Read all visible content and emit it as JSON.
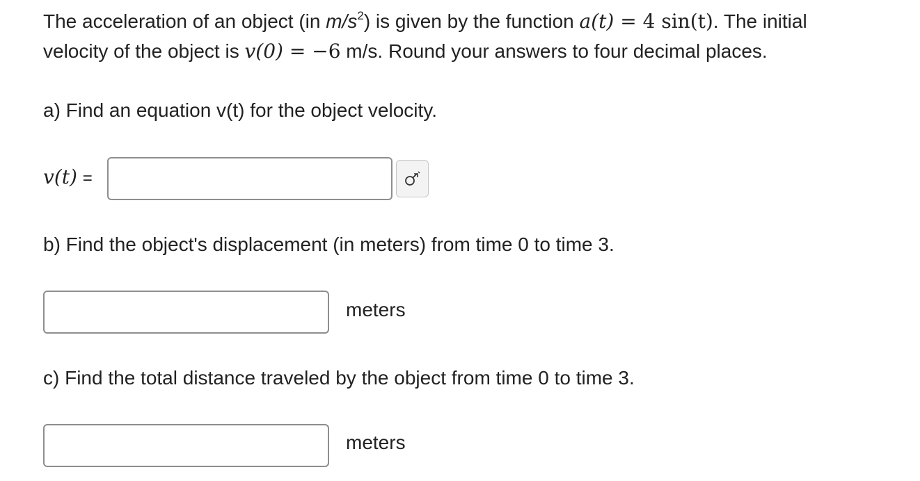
{
  "problem": {
    "line1_prefix": "The acceleration of an object (in ",
    "line1_unit": "m/s",
    "line1_unit_sup": "2",
    "line1_mid": ") is given by the function ",
    "line1_eq_lhs": "a(t)",
    "line1_eq_sign": "=",
    "line1_eq_rhs": "4 sin(t)",
    "line1_suffix": ". The initial",
    "line2_prefix": "velocity of the object is ",
    "line2_eq_lhs": "v(0)",
    "line2_eq_sign": "=",
    "line2_eq_rhs": "−6",
    "line2_suffix": " m/s. Round your answers to four decimal places."
  },
  "part_a": {
    "question": "a) Find an equation v(t) for the object velocity.",
    "label_math": "v(t)",
    "label_eq": "=",
    "input_value": "",
    "editor_icon": "equation-editor-icon"
  },
  "part_b": {
    "question": "b) Find the object's displacement (in meters) from time 0 to time 3.",
    "input_value": "",
    "unit": "meters"
  },
  "part_c": {
    "question": "c) Find the total distance traveled by the object from time 0 to time 3.",
    "input_value": "",
    "unit": "meters"
  }
}
